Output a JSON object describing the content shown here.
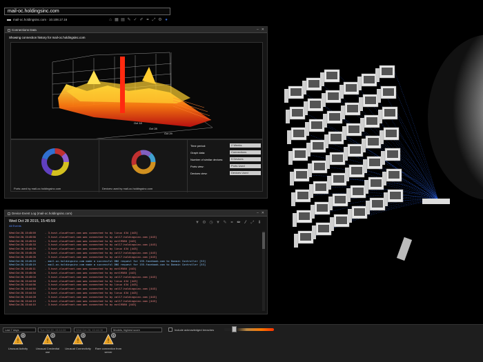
{
  "search": {
    "value": "mail-oc.holdingsinc.com"
  },
  "host_info": {
    "text": "mail-oc.holdingsinc.com · 10.108.17.16"
  },
  "connections_panel": {
    "title": "Connections Data",
    "subtitle": "Showing connection history for mail-oc.holdingsinc.com",
    "chart_dates": [
      "Oct 18",
      "Oct 28",
      "Oct 29"
    ],
    "ports_caption": "Ports used by mail-oc.holdingsinc.com",
    "devices_caption": "Devices used by mail-oc.holdingsinc.com",
    "stats": [
      {
        "label": "Time period:",
        "value": "2 Weeks"
      },
      {
        "label": "Graph data:",
        "value": "Connections"
      },
      {
        "label": "Number of similar devices:",
        "value": "5 Devices"
      },
      {
        "label": "Ports view:",
        "value": "Ports Used"
      },
      {
        "label": "Devices view:",
        "value": "Devices Used"
      }
    ]
  },
  "event_log": {
    "title": "Device Event Log (mail-oc.holdingsinc.com)",
    "heading": "Wed Oct 28 2015, 15:45:59",
    "subheading": "All Events",
    "rows": [
      {
        "ts": "Wed Oct 28, 15:45:59",
        "msg": "- 3.host.cloudfront.com was connected to by linux 434 [443]",
        "color": "red"
      },
      {
        "ts": "Wed Oct 28, 15:45:56",
        "msg": "- 3.host.cloudfront.com was connected to by cal17.holdingsinc.com [443]",
        "color": "red"
      },
      {
        "ts": "Wed Oct 28, 15:45:54",
        "msg": "- 3.host.cloudfront.com was connected to by ext19580 [443]",
        "color": "red"
      },
      {
        "ts": "Wed Oct 28, 15:45:33",
        "msg": "- 3.host.cloudfront.com was connected to by cal17.holdingsinc.com [443]",
        "color": "red"
      },
      {
        "ts": "Wed Oct 28, 15:45:29",
        "msg": "- 3.host.cloudfront.com was connected to by linux 434 [443]",
        "color": "red"
      },
      {
        "ts": "Wed Oct 28, 15:45:26",
        "msg": "- 3.host.cloudfront.com was connected to by cal17.holdingsinc.com [443]",
        "color": "red"
      },
      {
        "ts": "Wed Oct 28, 15:45:26",
        "msg": "- 3.host.cloudfront.com was connected to by cal17.holdingsinc.com [443]",
        "color": "red"
      },
      {
        "ts": "Wed Oct 28, 15:45:20",
        "msg": "- mail-oc.holdingsinc.com made a successful DNS request for 155.facebook.com to Domain Controller [53]",
        "color": "blue"
      },
      {
        "ts": "Wed Oct 28, 15:45:19",
        "msg": "- mail-oc.holdingsinc.com made a successful DNS request for 155.facebook.com to Domain Controller [53]",
        "color": "blue"
      },
      {
        "ts": "Wed Oct 28, 15:45:11",
        "msg": "- 3.host.cloudfront.com was connected to by ext19580 [443]",
        "color": "red"
      },
      {
        "ts": "Wed Oct 28, 15:45:06",
        "msg": "- 3.host.cloudfront.com was connected to by ext19580 [443]",
        "color": "red"
      },
      {
        "ts": "Wed Oct 28, 15:45:04",
        "msg": "- 3.host.cloudfront.com was connected to by cal17.holdingsinc.com [443]",
        "color": "red"
      },
      {
        "ts": "Wed Oct 28, 15:44:58",
        "msg": "- 3.host.cloudfront.com was connected to by linux 434 [443]",
        "color": "red"
      },
      {
        "ts": "Wed Oct 28, 15:44:56",
        "msg": "- 3.host.cloudfront.com was connected to by linux 434 [443]",
        "color": "red"
      },
      {
        "ts": "Wed Oct 28, 15:44:50",
        "msg": "- 3.host.cloudfront.com was connected to by cal17.holdingsinc.com [443]",
        "color": "red"
      },
      {
        "ts": "Wed Oct 28, 15:44:34",
        "msg": "- 3.host.cloudfront.com was connected to by linux 434 [443]",
        "color": "red"
      },
      {
        "ts": "Wed Oct 28, 15:44:28",
        "msg": "- 3.host.cloudfront.com was connected to by cal17.holdingsinc.com [443]",
        "color": "red"
      },
      {
        "ts": "Wed Oct 28, 15:44:19",
        "msg": "- 3.host.cloudfront.com was connected to by cal17.holdingsinc.com [443]",
        "color": "red"
      },
      {
        "ts": "Wed Oct 28, 15:44:10",
        "msg": "- 3.host.cloudfront.com was connected to by ext19580 [443]",
        "color": "red"
      }
    ]
  },
  "bottom_bar": {
    "filter_period": "Last 7 days",
    "filter_from": "Tue Oct 20, 15:44:08",
    "filter_to": "Wed Oct 28, 15:44:08",
    "filter_sort": "Models, highest score",
    "checkbox_label": "Include acknowledged breaches",
    "alerts": [
      {
        "label": "Unusual Activity",
        "count": "8"
      },
      {
        "label": "Unusual Credential use",
        "count": "1"
      },
      {
        "label": "Unusual Connectivity",
        "count": "3"
      },
      {
        "label": "Rare connection from server",
        "count": "1"
      }
    ]
  },
  "colors": {
    "accent": "#3366cc",
    "alert": "#e8a020",
    "log_red": "#ff8a8a",
    "log_blue": "#8cc8ff"
  }
}
